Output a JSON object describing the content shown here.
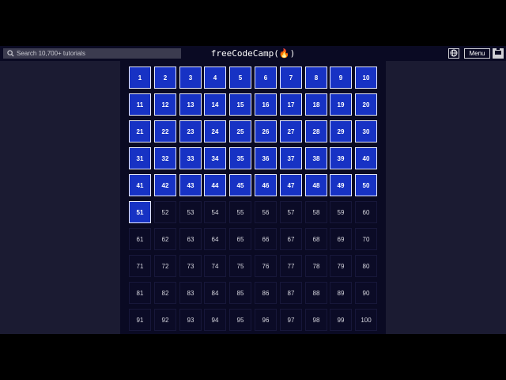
{
  "navbar": {
    "search_placeholder": "Search 10,700+ tutorials",
    "logo_text": "freeCodeCamp(🔥)",
    "menu_label": "Menu"
  },
  "grid": {
    "columns": 10,
    "checked_count": 51,
    "cells": [
      "1",
      "2",
      "3",
      "4",
      "5",
      "6",
      "7",
      "8",
      "9",
      "10",
      "11",
      "12",
      "13",
      "14",
      "15",
      "16",
      "17",
      "18",
      "19",
      "20",
      "21",
      "22",
      "23",
      "24",
      "25",
      "26",
      "27",
      "28",
      "29",
      "30",
      "31",
      "32",
      "33",
      "34",
      "35",
      "36",
      "37",
      "38",
      "39",
      "40",
      "41",
      "42",
      "43",
      "44",
      "45",
      "46",
      "47",
      "48",
      "49",
      "50",
      "51",
      "52",
      "53",
      "54",
      "55",
      "56",
      "57",
      "58",
      "59",
      "60",
      "61",
      "62",
      "63",
      "64",
      "65",
      "66",
      "67",
      "68",
      "69",
      "70",
      "71",
      "72",
      "73",
      "74",
      "75",
      "76",
      "77",
      "78",
      "79",
      "80",
      "81",
      "82",
      "83",
      "84",
      "85",
      "86",
      "87",
      "88",
      "89",
      "90",
      "91",
      "92",
      "93",
      "94",
      "95",
      "96",
      "97",
      "98",
      "99",
      "100"
    ]
  },
  "colors": {
    "page_bg": "#1b1b32",
    "navbar_bg": "#0a0a23",
    "checked_bg": "#1732c4",
    "checked_border": "#e6e9ff",
    "unchecked_bg": "#0b0b26"
  },
  "icons": {
    "search": "search-icon",
    "globe": "globe-icon",
    "avatar": "avatar-icon"
  }
}
